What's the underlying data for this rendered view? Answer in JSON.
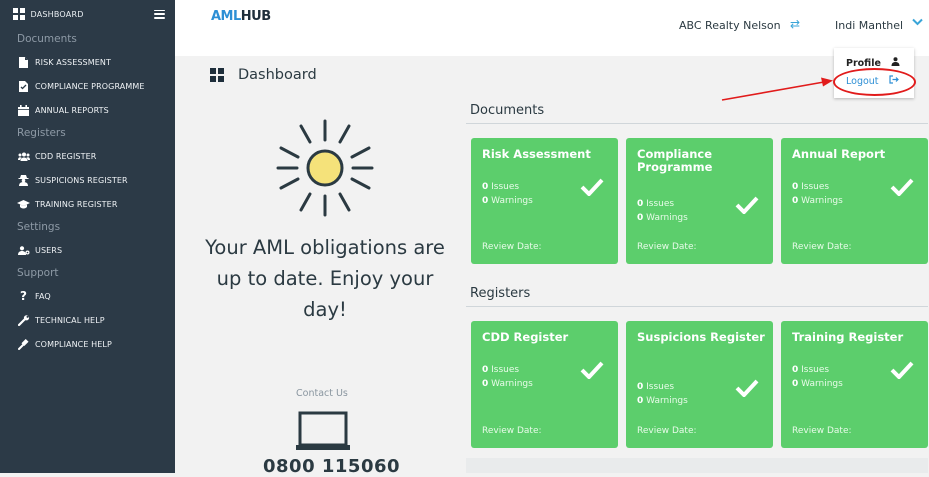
{
  "sidebar": {
    "top_label": "DASHBOARD",
    "sections": {
      "documents": "Documents",
      "registers": "Registers",
      "settings": "Settings",
      "support": "Support"
    },
    "items": {
      "risk_assessment": "RISK ASSESSMENT",
      "compliance_programme": "COMPLIANCE PROGRAMME",
      "annual_reports": "ANNUAL REPORTS",
      "cdd_register": "CDD REGISTER",
      "suspicions_register": "SUSPICIONS REGISTER",
      "training_register": "TRAINING REGISTER",
      "users": "USERS",
      "faq": "FAQ",
      "technical_help": "TECHNICAL HELP",
      "compliance_help": "COMPLIANCE HELP"
    }
  },
  "header": {
    "logo_part1": "AML",
    "logo_part2": "HUB",
    "org_name": "ABC Realty Nelson",
    "user_name": "Indi Manthel"
  },
  "dropdown": {
    "profile": "Profile",
    "logout": "Logout"
  },
  "main": {
    "title": "Dashboard",
    "tagline": "Your AML obligations are up to date. Enjoy your day!",
    "contact_label": "Contact Us",
    "phone": "0800 115060",
    "documents_heading": "Documents",
    "registers_heading": "Registers"
  },
  "cards": {
    "risk_assessment": {
      "title": "Risk Assessment",
      "issues": "0",
      "warnings": "0"
    },
    "compliance_programme": {
      "title": "Compliance Programme",
      "issues": "0",
      "warnings": "0"
    },
    "annual_report": {
      "title": "Annual Report",
      "issues": "0",
      "warnings": "0"
    },
    "cdd_register": {
      "title": "CDD Register",
      "issues": "0",
      "warnings": "0"
    },
    "suspicions_register": {
      "title": "Suspicions Register",
      "issues": "0",
      "warnings": "0"
    },
    "training_register": {
      "title": "Training Register",
      "issues": "0",
      "warnings": "0"
    }
  },
  "labels": {
    "issues": "Issues",
    "warnings": "Warnings",
    "review_date": "Review Date:"
  },
  "colors": {
    "sidebar_bg": "#2c3a47",
    "card_green": "#5cce6c",
    "accent_blue": "#2d8fd5",
    "annotation_red": "#e11b1b",
    "sun_fill": "#f5e27a"
  }
}
